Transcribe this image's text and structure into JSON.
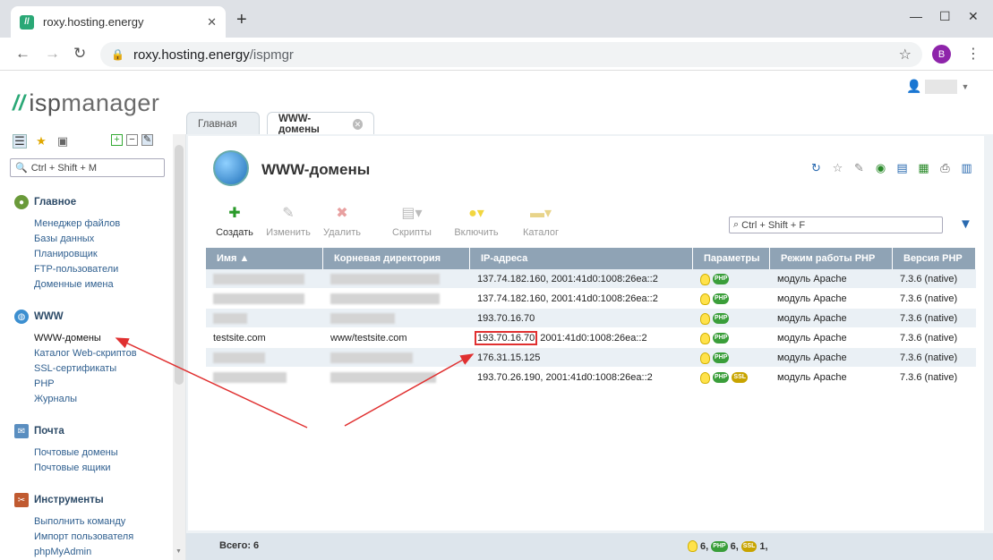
{
  "browser": {
    "tab_title": "roxy.hosting.energy",
    "url_host": "roxy.hosting.energy",
    "url_path": "/ispmgr",
    "profile_initial": "B"
  },
  "app": {
    "logo_text": "manager",
    "logo_isp": "isp",
    "tabs": [
      {
        "label": "Главная",
        "active": false
      },
      {
        "label": "WWW-домены",
        "active": true
      }
    ]
  },
  "sidebar": {
    "search_placeholder": "Ctrl + Shift + M",
    "sections": [
      {
        "title": "Главное",
        "icon": "main-icon",
        "items": [
          "Менеджер файлов",
          "Базы данных",
          "Планировщик",
          "FTP-пользователи",
          "Доменные имена"
        ]
      },
      {
        "title": "WWW",
        "icon": "www-icon",
        "items": [
          "WWW-домены",
          "Каталог Web-скриптов",
          "SSL-сертификаты",
          "PHP",
          "Журналы"
        ]
      },
      {
        "title": "Почта",
        "icon": "mail-icon",
        "items": [
          "Почтовые домены",
          "Почтовые ящики"
        ]
      },
      {
        "title": "Инструменты",
        "icon": "tools-icon",
        "items": [
          "Выполнить команду",
          "Импорт пользователя",
          "phpMyAdmin"
        ]
      }
    ]
  },
  "page": {
    "title": "WWW-домены",
    "toolbar": {
      "create": "Создать",
      "edit": "Изменить",
      "delete": "Удалить",
      "scripts": "Скрипты",
      "enable": "Включить",
      "catalog": "Каталог"
    },
    "filter_placeholder": "Ctrl + Shift + F",
    "columns": [
      "Имя ▲",
      "Корневая директория",
      "IP-адреса",
      "Параметры",
      "Режим работы PHP",
      "Версия PHP"
    ],
    "rows": [
      {
        "name": "",
        "root": "",
        "ip": "137.74.182.160, 2001:41d0:1008:26ea::2",
        "ssl": false,
        "mode": "модуль Apache",
        "version": "7.3.6 (native)"
      },
      {
        "name": "",
        "root": "",
        "ip": "137.74.182.160, 2001:41d0:1008:26ea::2",
        "ssl": false,
        "mode": "модуль Apache",
        "version": "7.3.6 (native)"
      },
      {
        "name": "",
        "root": "",
        "ip": "193.70.16.70",
        "ssl": false,
        "mode": "модуль Apache",
        "version": "7.3.6 (native)"
      },
      {
        "name": "testsite.com",
        "root": "www/testsite.com",
        "ip": "193.70.16.70",
        "ip_rest": " 2001:41d0:1008:26ea::2",
        "highlight": true,
        "ssl": false,
        "mode": "модуль Apache",
        "version": "7.3.6 (native)"
      },
      {
        "name": "",
        "root": "",
        "ip": "176.31.15.125",
        "ssl": false,
        "mode": "модуль Apache",
        "version": "7.3.6 (native)"
      },
      {
        "name": "",
        "root": "",
        "ip": "193.70.26.190, 2001:41d0:1008:26ea::2",
        "ssl": true,
        "mode": "модуль Apache",
        "version": "7.3.6 (native)"
      }
    ],
    "footer": {
      "total": "Всего: 6",
      "bulb_count": "6,",
      "php_count": "6,",
      "ssl_count": "1,"
    }
  },
  "colors": {
    "accent": "#2aa876",
    "header": "#8fa3b5",
    "annotation": "#e03030"
  }
}
